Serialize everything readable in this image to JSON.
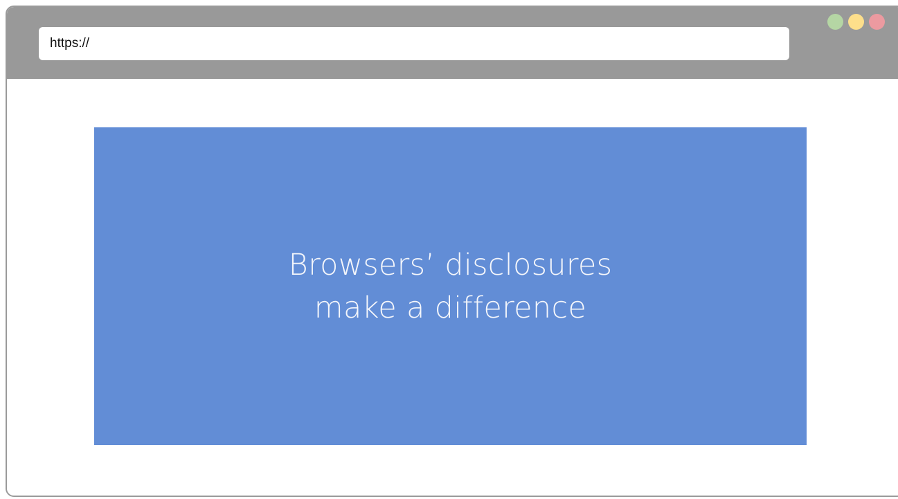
{
  "browser": {
    "address": "https://",
    "window_controls": [
      {
        "name": "green-dot-icon",
        "color": "#b5d6a4"
      },
      {
        "name": "yellow-dot-icon",
        "color": "#fddf8b"
      },
      {
        "name": "red-dot-icon",
        "color": "#ec9aa0"
      }
    ],
    "chrome_color": "#999999"
  },
  "slide": {
    "background": "#628dd6",
    "lines": [
      "Browsers’ disclosures",
      "make a difference"
    ]
  }
}
